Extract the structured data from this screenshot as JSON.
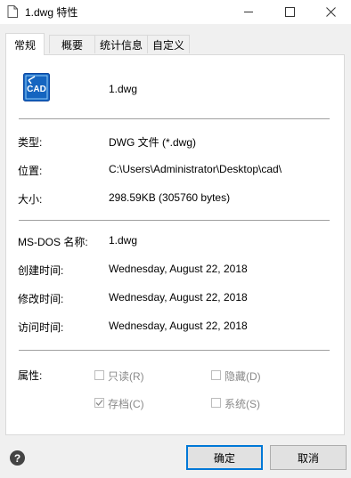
{
  "window": {
    "title": "1.dwg 特性"
  },
  "tabs": [
    {
      "label": "常规"
    },
    {
      "label": "概要"
    },
    {
      "label": "统计信息"
    },
    {
      "label": "自定义"
    }
  ],
  "general": {
    "file_name": "1.dwg",
    "icon_text": "CAD",
    "type_label": "类型:",
    "type_value": "DWG 文件 (*.dwg)",
    "location_label": "位置:",
    "location_value": "C:\\Users\\Administrator\\Desktop\\cad\\",
    "size_label": "大小:",
    "size_value": "298.59KB (305760 bytes)",
    "msdos_label": "MS-DOS 名称:",
    "msdos_value": "1.dwg",
    "created_label": "创建时间:",
    "created_value": "Wednesday, August 22, 2018",
    "modified_label": "修改时间:",
    "modified_value": "Wednesday, August 22, 2018",
    "accessed_label": "访问时间:",
    "accessed_value": "Wednesday, August 22, 2018",
    "attributes_label": "属性:",
    "attributes": {
      "readonly": {
        "label": "只读(R)",
        "checked": false
      },
      "hidden": {
        "label": "隐藏(D)",
        "checked": false
      },
      "archive": {
        "label": "存档(C)",
        "checked": true
      },
      "system": {
        "label": "系统(S)",
        "checked": false
      }
    }
  },
  "buttons": {
    "ok": "确定",
    "cancel": "取消"
  },
  "colors": {
    "accent": "#0078d7",
    "icon_blue": "#1565c0"
  }
}
